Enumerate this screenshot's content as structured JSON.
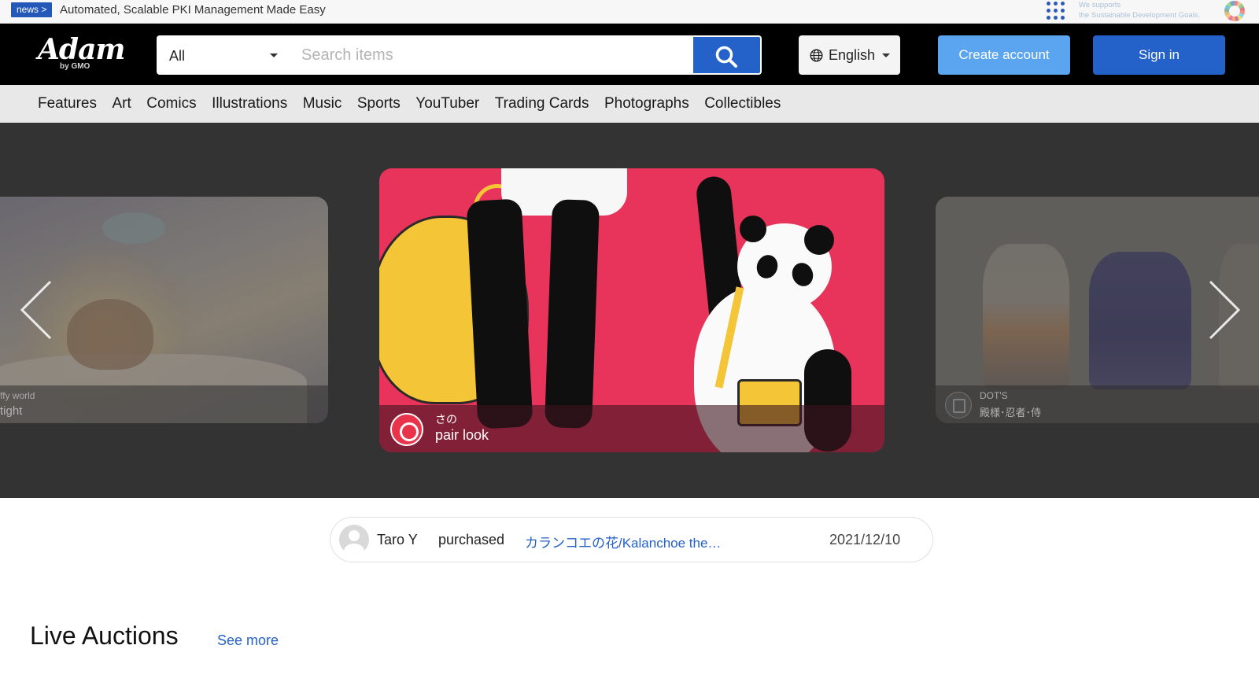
{
  "news": {
    "badge": "news >",
    "text": "Automated, Scalable PKI Management Made Easy",
    "sdg_line1": "We supports",
    "sdg_line2": "the Sustainable Development Goals."
  },
  "header": {
    "logo_main": "Adam",
    "logo_sub": "by GMO",
    "category_value": "All",
    "search_placeholder": "Search items",
    "language": "English",
    "create_account": "Create account",
    "sign_in": "Sign in"
  },
  "nav": {
    "items": [
      "Features",
      "Art",
      "Comics",
      "Illustrations",
      "Music",
      "Sports",
      "YouTuber",
      "Trading Cards",
      "Photographs",
      "Collectibles"
    ]
  },
  "carousel": {
    "left": {
      "artist": "ffy world",
      "title": "tight"
    },
    "center": {
      "artist": "さの",
      "title": "pair look"
    },
    "right": {
      "artist": "DOT'S",
      "title": "殿様･忍者･侍"
    }
  },
  "ticker": {
    "user": "Taro Y",
    "verb": "purchased",
    "item": "カランコエの花/Kalanchoe the…",
    "date": "2021/12/10"
  },
  "live_auctions": {
    "title": "Live Auctions",
    "see_more": "See more"
  },
  "colors": {
    "brand_blue": "#2461c8",
    "create_blue": "#5aa4f0",
    "header_bg": "#000000",
    "hero_bg": "#333333"
  },
  "icons": [
    "apps-grid-icon",
    "sdg-wheel-icon",
    "search-icon",
    "globe-icon",
    "caret-down-icon",
    "chevron-left-icon",
    "chevron-right-icon",
    "avatar-icon"
  ]
}
